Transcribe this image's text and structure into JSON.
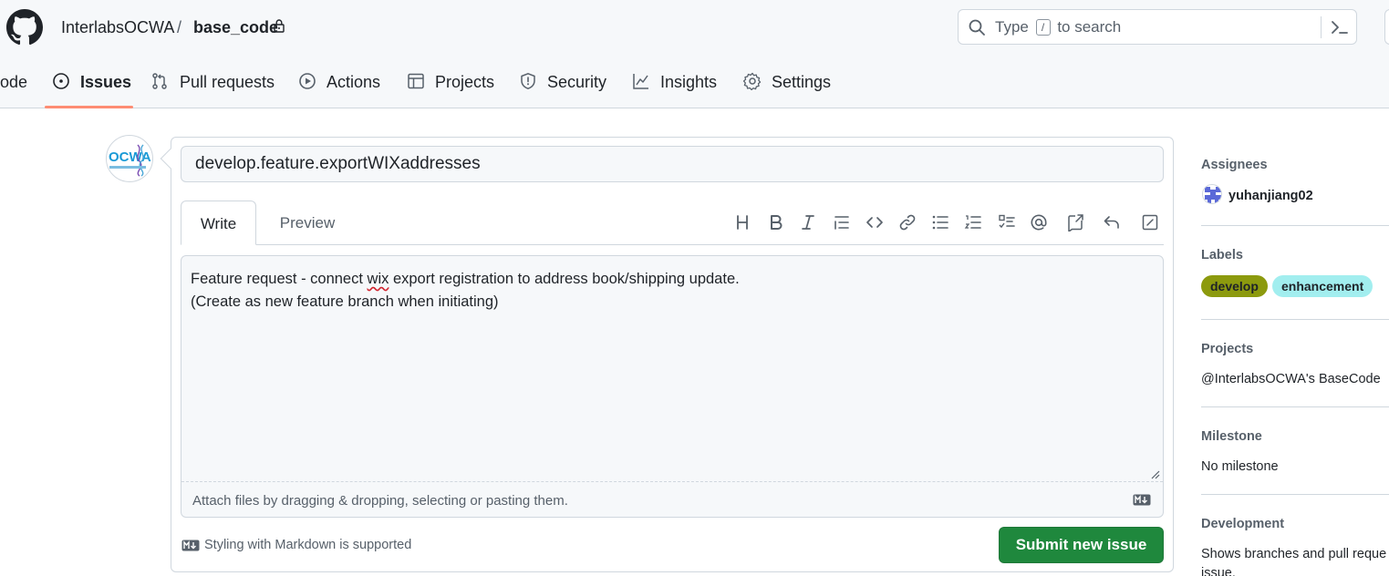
{
  "header": {
    "owner": "InterlabsOCWA",
    "separator": "/",
    "repo": "base_code",
    "search": {
      "prefix": "Type",
      "key": "/",
      "suffix": "to search"
    }
  },
  "nav": {
    "tabs": [
      {
        "label": "ode",
        "icon": "code-icon"
      },
      {
        "label": "Issues",
        "icon": "issue-opened-icon",
        "active": true
      },
      {
        "label": "Pull requests",
        "icon": "git-pull-request-icon"
      },
      {
        "label": "Actions",
        "icon": "play-icon"
      },
      {
        "label": "Projects",
        "icon": "table-icon"
      },
      {
        "label": "Security",
        "icon": "shield-icon"
      },
      {
        "label": "Insights",
        "icon": "graph-icon"
      },
      {
        "label": "Settings",
        "icon": "gear-icon"
      }
    ]
  },
  "form": {
    "title_value": "develop.feature.exportWIXaddresses",
    "tab_write": "Write",
    "tab_preview": "Preview",
    "body_line1_a": "Feature request - connect ",
    "body_line1_b": "wix",
    "body_line1_c": " export registration to address book/shipping update.",
    "body_line2": "(Create as new feature branch when initiating)",
    "attach_hint": "Attach files by dragging & dropping, selecting or pasting them.",
    "markdown_note": "Styling with Markdown is supported",
    "submit_label": "Submit new issue",
    "toolbar": [
      "heading-icon",
      "bold-icon",
      "italic-icon",
      "quote-icon",
      "code-icon",
      "link-icon",
      "unordered-list-icon",
      "ordered-list-icon",
      "tasklist-icon",
      "mention-icon",
      "cross-reference-icon",
      "reply-icon",
      "fullscreen-icon"
    ]
  },
  "sidebar": {
    "assignees_heading": "Assignees",
    "assignee": "yuhanjiang02",
    "labels_heading": "Labels",
    "labels": [
      {
        "name": "develop",
        "color": "#8c9a0e"
      },
      {
        "name": "enhancement",
        "color": "#a2eeef"
      }
    ],
    "projects_heading": "Projects",
    "project": "@InterlabsOCWA's BaseCode",
    "milestone_heading": "Milestone",
    "milestone": "No milestone",
    "development_heading": "Development",
    "development_line1": "Shows branches and pull reque",
    "development_line2": "issue."
  },
  "colors": {
    "accent_underline": "#fd8c73",
    "submit_green": "#1f883d"
  }
}
